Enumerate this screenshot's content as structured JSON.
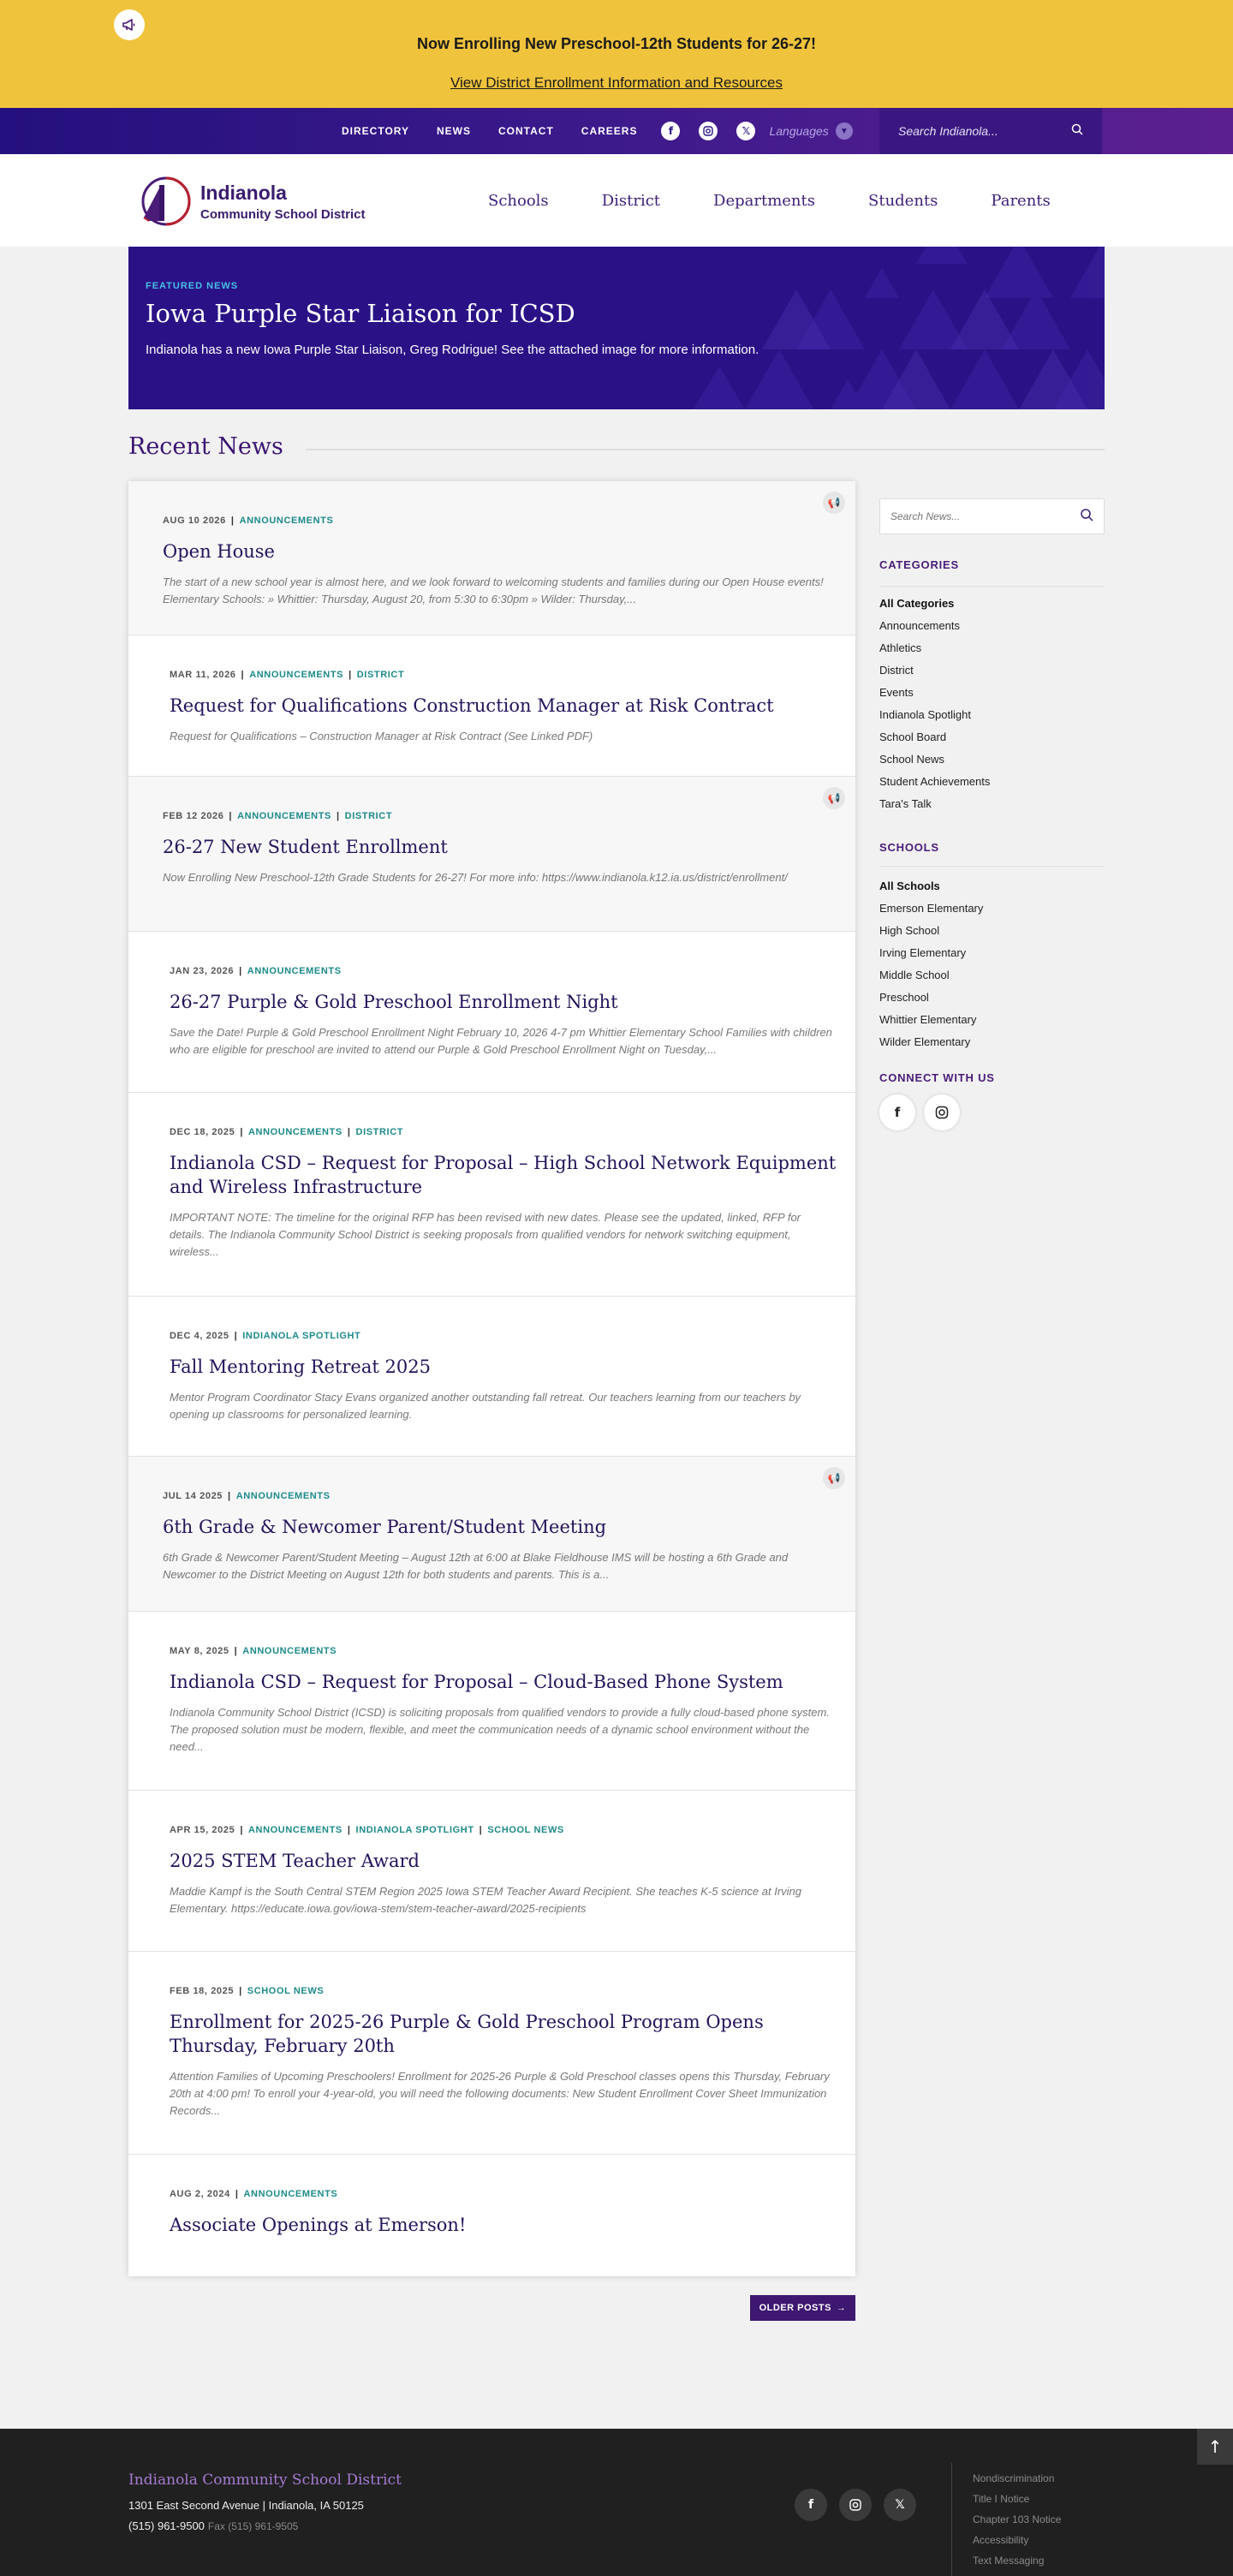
{
  "alert": {
    "icon": "megaphone-icon",
    "title": "Now Enrolling New Preschool-12th Students for 26-27!",
    "link": "View District Enrollment Information and Resources"
  },
  "utility": {
    "links": [
      "DIRECTORY",
      "NEWS",
      "CONTACT",
      "CAREERS"
    ],
    "languages": "Languages",
    "search_placeholder": "Search Indianola..."
  },
  "header": {
    "logo_name": "Indianola",
    "logo_sub": "Community School District",
    "nav": [
      "Schools",
      "District",
      "Departments",
      "Students",
      "Parents"
    ]
  },
  "featured": {
    "label": "FEATURED NEWS",
    "title": "Iowa Purple Star Liaison for ICSD",
    "desc": "Indianola has a new Iowa Purple Star Liaison, Greg Rodrigue!  See the attached image for more information."
  },
  "section_title": "Recent News",
  "posts": [
    {
      "date": "AUG 10 2026",
      "cats": [
        "ANNOUNCEMENTS"
      ],
      "title": "Open House",
      "excerpt": "The start of a new school year is almost here, and we look forward to welcoming students and families during our Open House events! Elementary Schools: » Whittier: Thursday, August 20, from 5:30 to 6:30pm » Wilder: Thursday,..."
    },
    {
      "date": "MAR 11, 2026",
      "cats": [
        "ANNOUNCEMENTS",
        "DISTRICT"
      ],
      "title": "Request for Qualifications Construction Manager at Risk Contract",
      "excerpt": "Request for Qualifications – Construction Manager at Risk Contract (See Linked PDF)"
    },
    {
      "date": "FEB 12 2026",
      "cats": [
        "ANNOUNCEMENTS",
        "DISTRICT"
      ],
      "title": "26-27 New Student Enrollment",
      "excerpt": "Now Enrolling New Preschool-12th Grade Students for 26-27! For more info: https://www.indianola.k12.ia.us/district/enrollment/"
    },
    {
      "date": "JAN 23, 2026",
      "cats": [
        "ANNOUNCEMENTS"
      ],
      "title": "26-27 Purple & Gold Preschool Enrollment Night",
      "excerpt": "Save the Date! Purple & Gold Preschool Enrollment Night February 10, 2026 4-7 pm Whittier Elementary School Families with children who are eligible for preschool are invited to attend our Purple & Gold Preschool Enrollment Night on Tuesday,..."
    },
    {
      "date": "DEC 18, 2025",
      "cats": [
        "ANNOUNCEMENTS",
        "DISTRICT"
      ],
      "title": "Indianola CSD – Request for Proposal – High School Network Equipment and Wireless Infrastructure",
      "excerpt": "IMPORTANT NOTE: The timeline for the original RFP has been revised with new dates.  Please see the updated, linked, RFP for details. The Indianola Community School District is seeking proposals from qualified vendors for network switching equipment, wireless..."
    },
    {
      "date": "DEC 4, 2025",
      "cats": [
        "INDIANOLA SPOTLIGHT"
      ],
      "title": "Fall Mentoring Retreat 2025",
      "excerpt": "Mentor Program Coordinator Stacy Evans organized another outstanding fall retreat. Our teachers learning from our teachers by opening up classrooms for personalized learning."
    },
    {
      "date": "JUL 14 2025",
      "cats": [
        "ANNOUNCEMENTS"
      ],
      "title": "6th Grade & Newcomer Parent/Student Meeting",
      "excerpt": "6th Grade & Newcomer Parent/Student Meeting – August 12th at 6:00 at Blake Fieldhouse IMS will be hosting a 6th Grade and Newcomer to the District Meeting on August 12th for both students and parents. This is a..."
    },
    {
      "date": "MAY 8, 2025",
      "cats": [
        "ANNOUNCEMENTS"
      ],
      "title": "Indianola CSD – Request for Proposal – Cloud-Based Phone System",
      "excerpt": "Indianola Community School District (ICSD) is soliciting proposals from qualified vendors to provide a fully cloud-based phone system. The proposed solution must be modern, flexible, and meet the communication needs of a dynamic school environment without the need..."
    },
    {
      "date": "APR 15, 2025",
      "cats": [
        "ANNOUNCEMENTS",
        "INDIANOLA SPOTLIGHT",
        "SCHOOL NEWS"
      ],
      "title": "2025 STEM Teacher Award",
      "excerpt": "Maddie Kampf is the South Central STEM Region 2025 Iowa STEM Teacher Award Recipient. She teaches K-5 science at Irving Elementary. https://educate.iowa.gov/iowa-stem/stem-teacher-award/2025-recipients"
    },
    {
      "date": "FEB 18, 2025",
      "cats": [
        "SCHOOL NEWS"
      ],
      "title": "Enrollment for 2025-26 Purple & Gold Preschool Program Opens Thursday, February 20th",
      "excerpt": "Attention Families of Upcoming Preschoolers! Enrollment for 2025-26 Purple & Gold Preschool classes opens this Thursday, February 20th at 4:00 pm! To enroll your 4-year-old, you will need the following documents: New Student Enrollment Cover Sheet Immunization Records..."
    },
    {
      "date": "AUG 2, 2024",
      "cats": [
        "ANNOUNCEMENTS"
      ],
      "title": "Associate Openings at Emerson!",
      "excerpt": ""
    }
  ],
  "older_posts": "OLDER POSTS",
  "sidebar": {
    "search_placeholder": "Search News...",
    "categories_heading": "CATEGORIES",
    "categories": [
      "All Categories",
      "Announcements",
      "Athletics",
      "District",
      "Events",
      "Indianola Spotlight",
      "School Board",
      "School News",
      "Student Achievements",
      "Tara's Talk"
    ],
    "schools_heading": "SCHOOLS",
    "schools": [
      "All Schools",
      "Emerson Elementary",
      "High School",
      "Irving Elementary",
      "Middle School",
      "Preschool",
      "Whittier Elementary",
      "Wilder Elementary"
    ],
    "connect_heading": "CONNECT WITH US"
  },
  "footer": {
    "name": "Indianola Community School District",
    "address": "1301 East Second Avenue  |  Indianola, IA 50125",
    "phone": "(515) 961-9500",
    "fax": "Fax (515) 961-9505",
    "links": [
      "Nondiscrimination",
      "Title I Notice",
      "Chapter 103 Notice",
      "Accessibility",
      "Text Messaging"
    ]
  },
  "colors": {
    "alert": "#f0c33c",
    "purple_dark": "#2a1286",
    "teal": "#1d8a8a",
    "footer": "#202020"
  }
}
